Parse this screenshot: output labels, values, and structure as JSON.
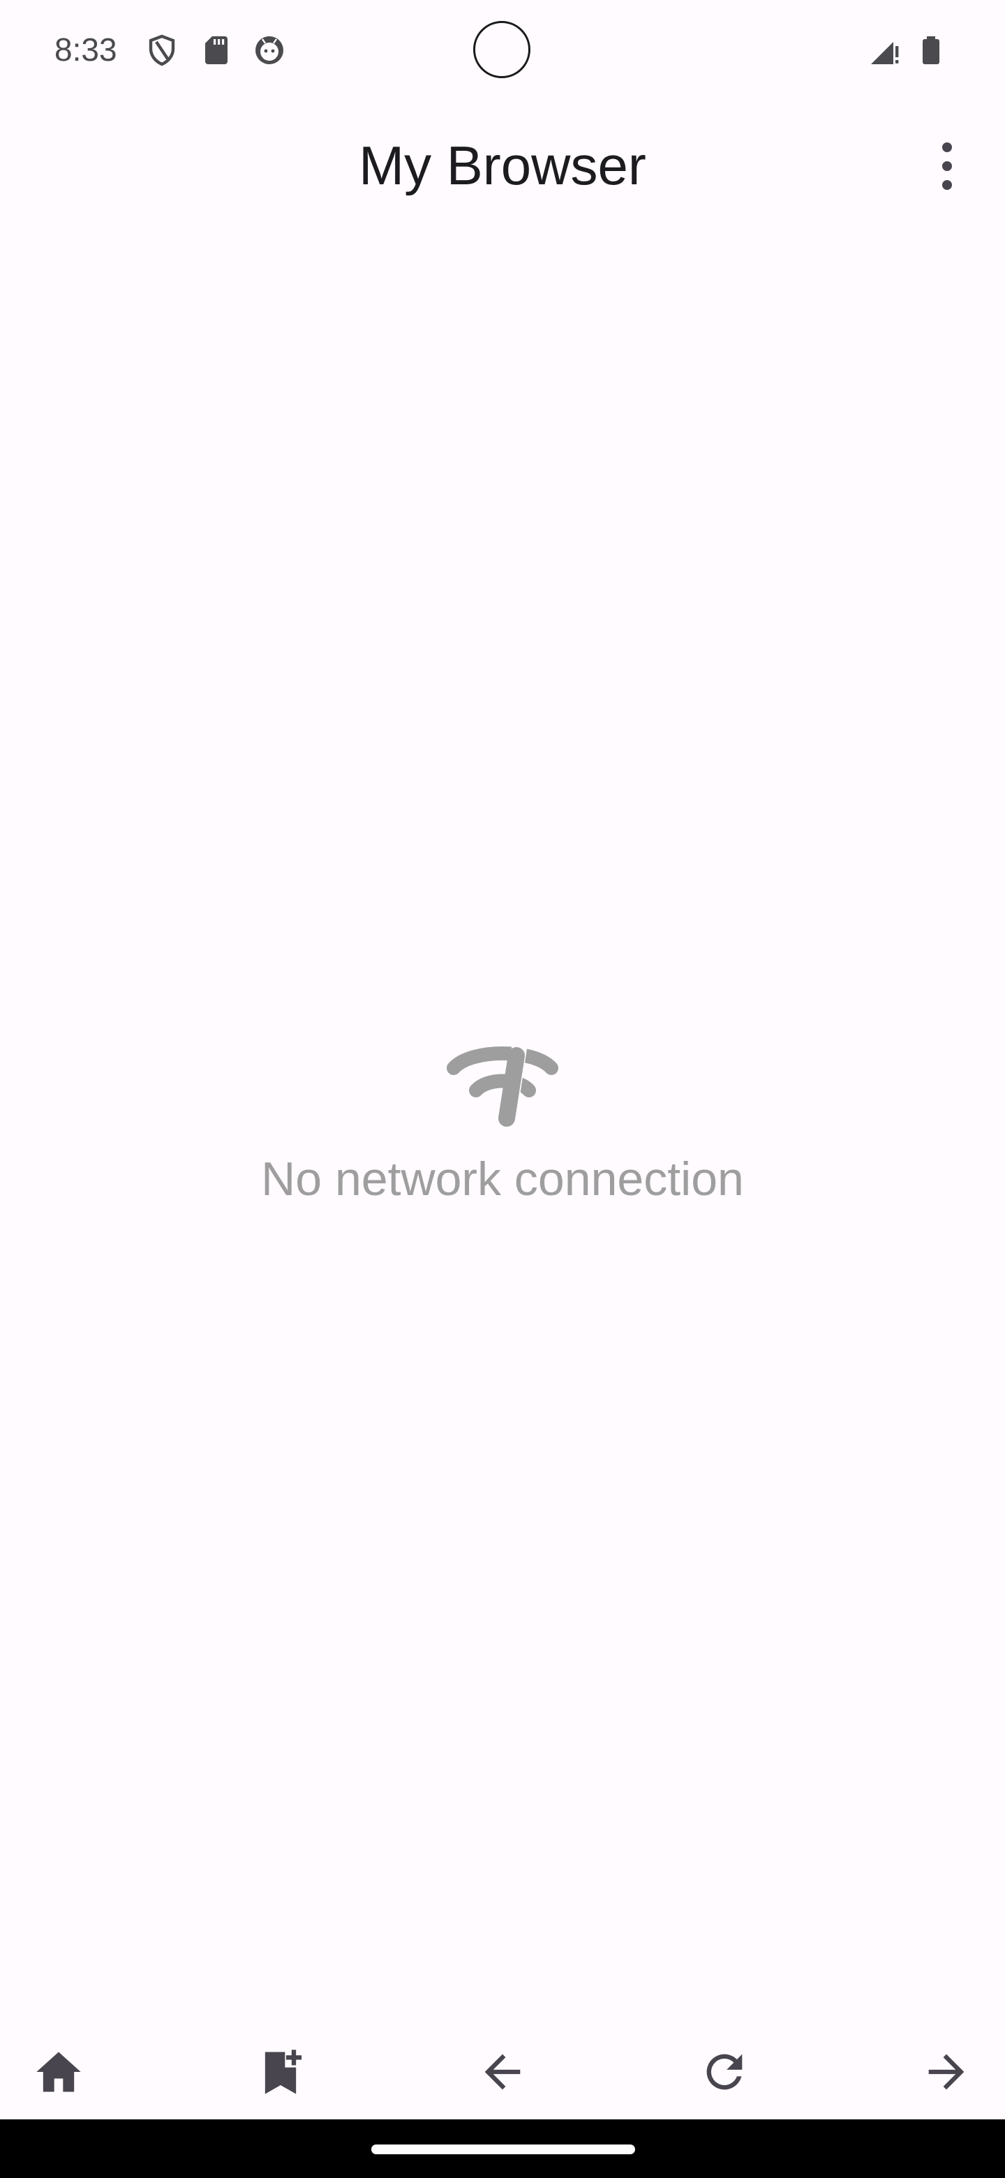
{
  "status_bar": {
    "time": "8:33",
    "icons": [
      "shield-icon",
      "sd-card-icon",
      "android-face-icon",
      "signal-icon",
      "battery-icon"
    ]
  },
  "app_bar": {
    "title": "My Browser",
    "overflow_icon": "more-vert-icon"
  },
  "content": {
    "empty_icon": "wifi-off-icon",
    "message": "No network connection"
  },
  "bottom_nav": {
    "icons": [
      "home-icon",
      "bookmark-add-icon",
      "arrow-back-icon",
      "refresh-icon",
      "arrow-forward-icon"
    ]
  },
  "colors": {
    "background": "#fffbfe",
    "text_primary": "#1c1b1f",
    "icon": "#49454f",
    "empty_gray": "#9e9e9e"
  }
}
